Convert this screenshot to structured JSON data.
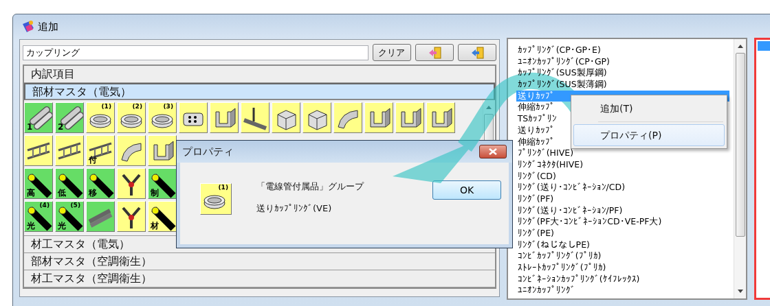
{
  "window": {
    "title": "追加"
  },
  "search": {
    "value": "カップリング"
  },
  "toolbar": [
    {
      "kind": "text",
      "label": "クリア"
    },
    {
      "kind": "import"
    },
    {
      "kind": "export"
    }
  ],
  "sections": [
    {
      "label": "内訳項目",
      "selected": false
    },
    {
      "label": "部材マスタ（電気）",
      "selected": true,
      "icon_rows": [
        [
          {
            "kind": "pipe",
            "color": "#66dd66",
            "label": "1"
          },
          {
            "kind": "pipe",
            "color": "#66dd66",
            "label": "2"
          },
          {
            "kind": "coupling",
            "color": "#ffff88",
            "number": "(1)"
          },
          {
            "kind": "coupling",
            "color": "#ffff88",
            "number": "(2)"
          },
          {
            "kind": "coupling",
            "color": "#ffff88",
            "number": "(3)"
          },
          {
            "kind": "block",
            "color": "#ffff88"
          },
          {
            "kind": "channel",
            "color": "#ffff88"
          },
          {
            "kind": "hanger",
            "color": "#ffff88"
          },
          {
            "kind": "box",
            "color": "#ffff88"
          },
          {
            "kind": "box",
            "color": "#ffff88"
          },
          {
            "kind": "saddle",
            "color": "#ffff88"
          },
          {
            "kind": "channel",
            "color": "#ffff88"
          },
          {
            "kind": "channel",
            "color": "#ffff88"
          },
          {
            "kind": "channel",
            "color": "#ffff88"
          }
        ],
        [
          {
            "kind": "tray",
            "color": "#ffff88"
          },
          {
            "kind": "tray",
            "color": "#ffff88"
          },
          {
            "kind": "tray",
            "color": "#ffff88",
            "label": "付"
          },
          {
            "kind": "saddle",
            "color": "#ffff88"
          },
          {
            "kind": "channel",
            "color": "#ffff88"
          }
        ],
        [
          {
            "kind": "cable",
            "color": "#66dd66",
            "label": "高"
          },
          {
            "kind": "cable",
            "color": "#66dd66",
            "label": "低"
          },
          {
            "kind": "cable",
            "color": "#66dd66",
            "label": "移"
          },
          {
            "kind": "branch",
            "color": "#ffff88"
          },
          {
            "kind": "cable",
            "color": "#66dd66",
            "label": "制"
          }
        ],
        [
          {
            "kind": "cable",
            "color": "#66dd66",
            "number": "(4)",
            "label": "光"
          },
          {
            "kind": "cable",
            "color": "#66dd66",
            "number": "(5)",
            "label": "光"
          },
          {
            "kind": "bundle",
            "color": "#66dd66"
          },
          {
            "kind": "branch",
            "color": "#ffff88"
          },
          {
            "kind": "cable",
            "color": "#ffff88",
            "label": "材"
          }
        ]
      ]
    },
    {
      "label": "材工マスタ（電気）",
      "selected": false
    },
    {
      "label": "部材マスタ（空調衛生）",
      "selected": false
    },
    {
      "label": "材工マスタ（空調衛生）",
      "selected": false
    }
  ],
  "list": {
    "items": [
      {
        "text": "ｶｯﾌﾟﾘﾝｸﾞ(CP･GP･E)",
        "selected": false
      },
      {
        "text": "ﾕﾆｵﾝｶｯﾌﾟﾘﾝｸﾞ(CP･GP)",
        "selected": false
      },
      {
        "text": "ｶｯﾌﾟﾘﾝｸﾞ(SUS製厚鋼)",
        "selected": false
      },
      {
        "text": "ｶｯﾌﾟﾘﾝｸﾞ(SUS製薄鋼)",
        "selected": false
      },
      {
        "text": "送りｶｯﾌﾟ",
        "selected": true
      },
      {
        "text": "伸縮ｶｯﾌﾟ",
        "selected": false
      },
      {
        "text": "TSｶｯﾌﾟﾘﾝ",
        "selected": false
      },
      {
        "text": "送りｶｯﾌﾟ",
        "selected": false
      },
      {
        "text": "伸縮ｶｯﾌﾟ",
        "selected": false
      },
      {
        "text": "ﾌﾟﾘﾝｸﾞ(HIVE)",
        "selected": false
      },
      {
        "text": "ﾘﾝｸﾞｺﾈｸﾀ(HIVE)",
        "selected": false
      },
      {
        "text": "ﾘﾝｸﾞ(CD)",
        "selected": false
      },
      {
        "text": "ﾘﾝｸﾞ(送り･ｺﾝﾋﾞﾈｰｼｮﾝ/CD)",
        "selected": false
      },
      {
        "text": "ﾘﾝｸﾞ(PF)",
        "selected": false
      },
      {
        "text": "ﾘﾝｸﾞ(送り･ｺﾝﾋﾞﾈｰｼｮﾝ/PF)",
        "selected": false
      },
      {
        "text": "ﾘﾝｸﾞ(PF大･ｺﾝﾋﾞﾈｰｼｮﾝCD･VE-PF大)",
        "selected": false
      },
      {
        "text": "ﾘﾝｸﾞ(PE)",
        "selected": false
      },
      {
        "text": "ﾘﾝｸﾞ(ねじなしPE)",
        "selected": false
      },
      {
        "text": "ｺﾝﾋﾞｶｯﾌﾟﾘﾝｸﾞ(ﾌﾟﾘｶ)",
        "selected": false
      },
      {
        "text": "ｽﾄﾚｰﾄｶｯﾌﾟﾘﾝｸﾞ(ﾌﾟﾘｶ)",
        "selected": false
      },
      {
        "text": "ｺﾝﾋﾞﾈｰｼｮﾝｶｯﾌﾟﾘﾝｸﾞ(ｹｲﾌﾚｯｸｽ)",
        "selected": false
      },
      {
        "text": "ﾕﾆｵﾝｶｯﾌﾟﾘﾝｸﾞ",
        "selected": false
      }
    ]
  },
  "context_menu": {
    "items": [
      {
        "label": "追加(T)",
        "selected": false
      },
      {
        "label": "プロパティ(P)",
        "selected": true
      }
    ]
  },
  "dialog": {
    "title": "プロパティ",
    "icon": {
      "kind": "coupling",
      "number": "(1)"
    },
    "group": "「電線管付属品」グループ",
    "name": "送りｶｯﾌﾟﾘﾝｸﾞ(VE)",
    "button": "OK"
  }
}
